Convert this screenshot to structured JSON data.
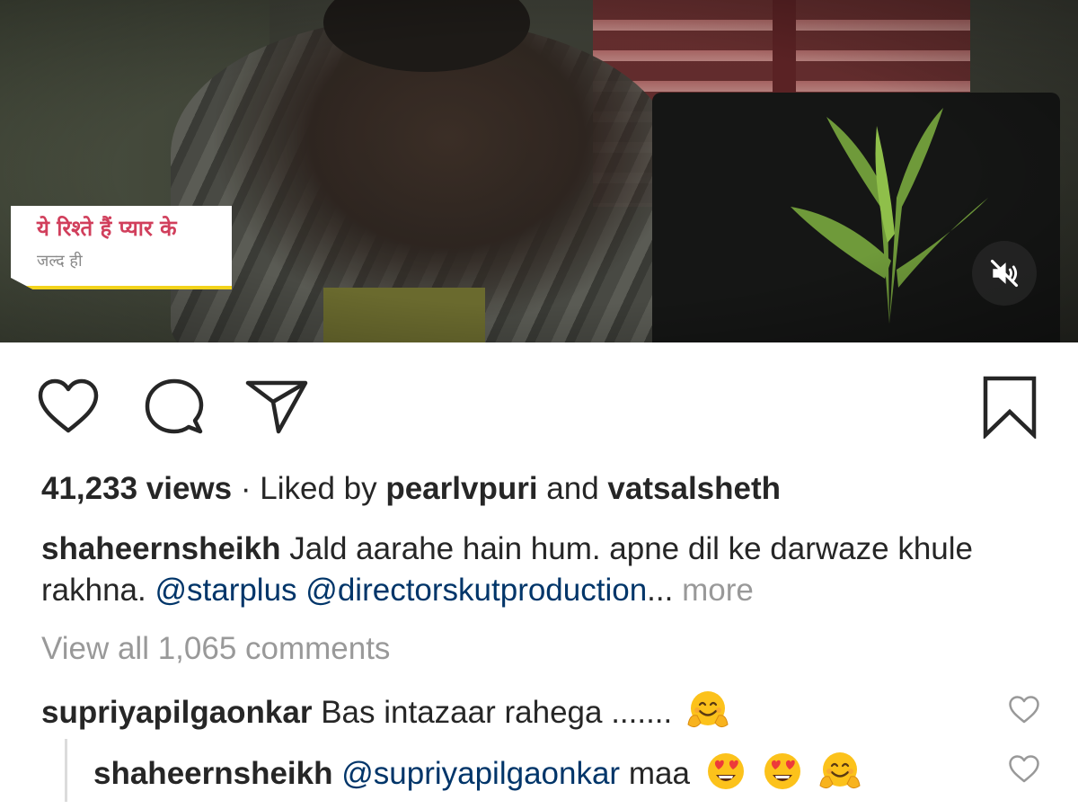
{
  "video": {
    "overlay_title": "ये रिश्ते हैं प्यार के",
    "overlay_subtitle": "जल्द ही",
    "muted": true,
    "mute_icon": "speaker-muted-icon"
  },
  "actions": {
    "like_icon": "heart-icon",
    "comment_icon": "comment-bubble-icon",
    "share_icon": "paper-plane-icon",
    "save_icon": "bookmark-icon"
  },
  "post": {
    "views": "41,233 views",
    "separator": " · ",
    "liked_by_prefix": "Liked by ",
    "liked_by_user_1": "pearlvpuri",
    "liked_by_joiner": " and ",
    "liked_by_user_2": "vatsalsheth",
    "caption_user": "shaheernsheikh",
    "caption_text": " Jald aarahe hain hum. apne dil ke darwaze khule rakhna. ",
    "caption_mention_1": "@starplus",
    "caption_mention_2": "@directorskutproduction",
    "caption_ellipsis": "...",
    "more_label": " more",
    "view_all_comments": "View all 1,065 comments"
  },
  "comments": [
    {
      "user": "supriyapilgaonkar",
      "text": " Bas intazaar rahega .......",
      "emojis": [
        "hugging-face"
      ]
    },
    {
      "user": "shaheernsheikh",
      "mention": "@supriyapilgaonkar",
      "text": " maa",
      "emojis": [
        "heart-eyes-face",
        "heart-eyes-face",
        "hugging-face"
      ],
      "is_reply": true
    }
  ],
  "colors": {
    "text": "#262626",
    "muted": "#999999",
    "mention": "#003569",
    "badge_title": "#d13f5c",
    "badge_underline": "#f2d31b"
  }
}
